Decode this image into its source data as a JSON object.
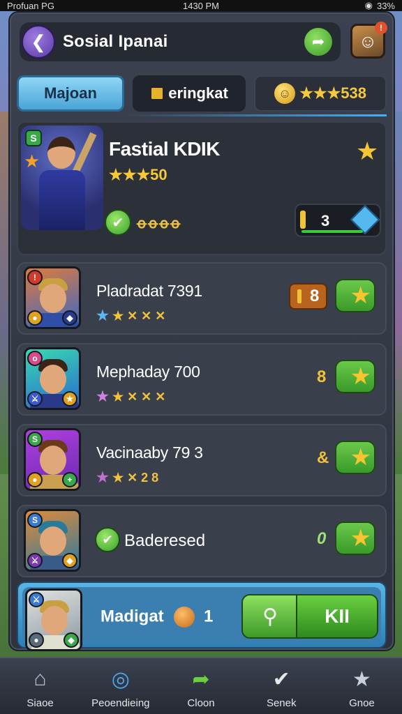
{
  "status_bar": {
    "carrier": "Profuan PG",
    "time": "1430 PM",
    "battery": "33%"
  },
  "header": {
    "title": "Sosial Ipanai",
    "badge": "!"
  },
  "tabs": [
    {
      "label": "Majoan"
    },
    {
      "label": "eringkat"
    },
    {
      "label": "★★★538"
    }
  ],
  "featured": {
    "level": "S",
    "name": "Fastial KDIK",
    "rating": "★★★50",
    "stat_text": "ꝋꝋꝋꝋ",
    "counter": "3"
  },
  "rows": [
    {
      "name": "Pladradat 7391",
      "stars": "★ ✕ ✕ ✕",
      "count": "8",
      "corner_tl": "!"
    },
    {
      "name": "Mephaday 700",
      "stars": "★ ✕ ✕ ✕",
      "count": "8",
      "corner_tl": "o"
    },
    {
      "name": "Vacinaaby 79 3",
      "stars": "★ ✕ 2 8",
      "count": "&",
      "corner_tl": "S"
    },
    {
      "name": "Baderesed",
      "count": "0",
      "corner_tl": "S"
    }
  ],
  "footer_row": {
    "name": "Madigat",
    "value": "1",
    "action_label": "KII"
  },
  "bottom_nav": [
    {
      "label": "Siaoe",
      "icon": "home-icon"
    },
    {
      "label": "Peoendieing",
      "icon": "compass-icon"
    },
    {
      "label": "Cloon",
      "icon": "share-icon"
    },
    {
      "label": "Senek",
      "icon": "check-icon"
    },
    {
      "label": "Gnoe",
      "icon": "star-icon"
    }
  ]
}
